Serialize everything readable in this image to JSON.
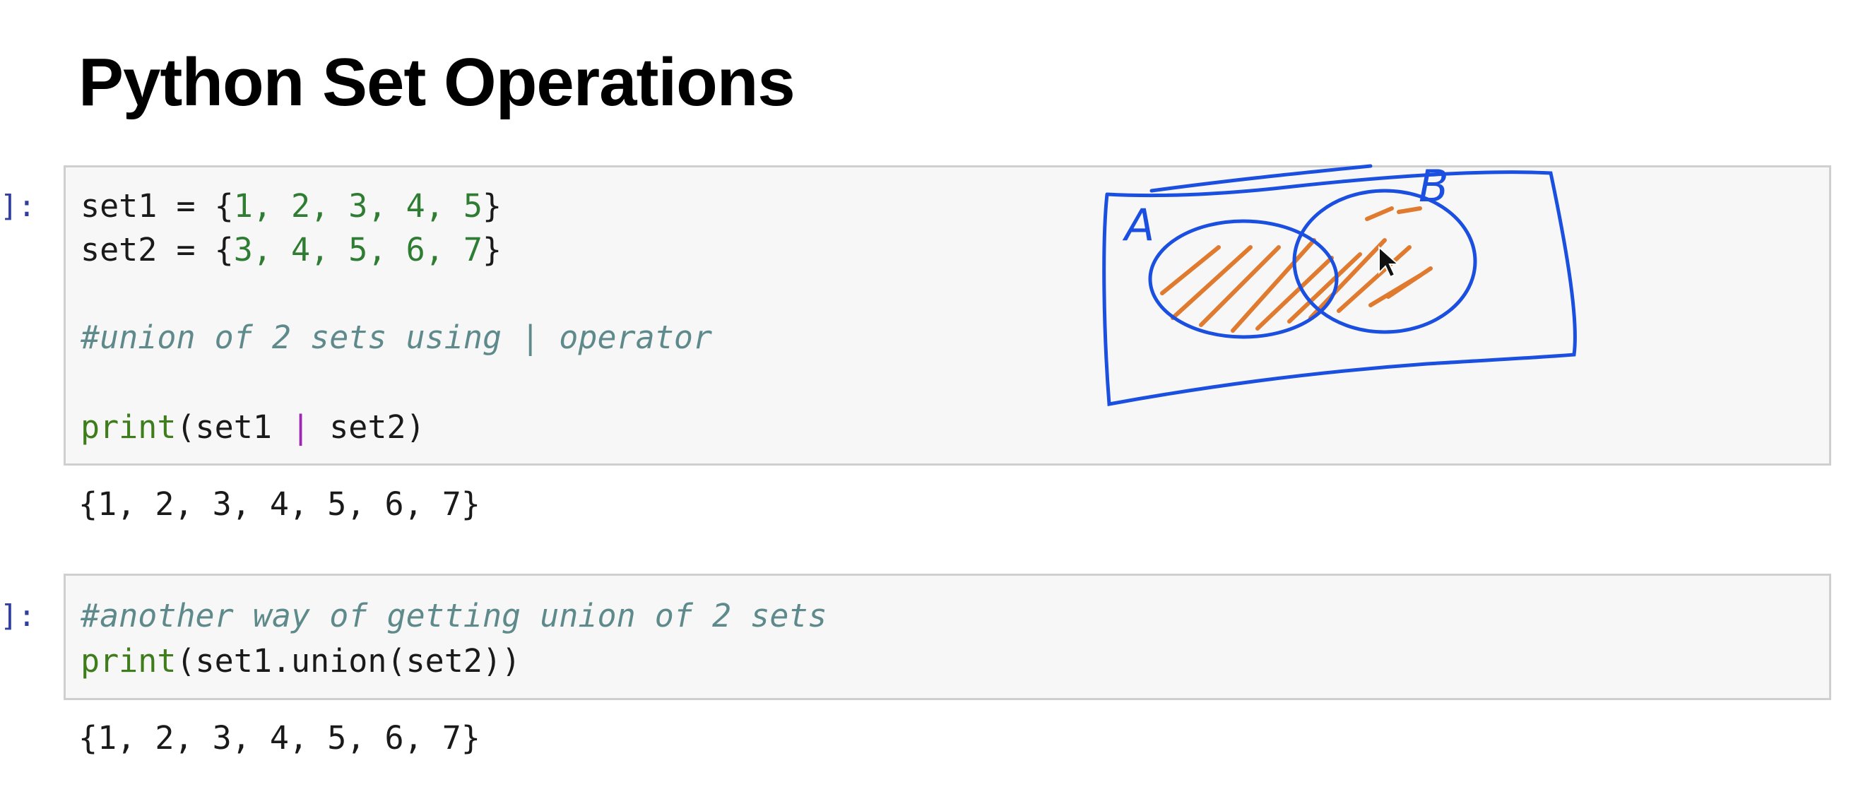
{
  "notebook": {
    "title": "Python Set Operations",
    "cells": [
      {
        "prompt": "]:",
        "lines": {
          "set1_var": "set1 = {",
          "set1_values": "1, 2, 3, 4, 5",
          "set1_close": "}",
          "set2_var": "set2 = {",
          "set2_values": "3, 4, 5, 6, 7",
          "set2_close": "}",
          "comment": "#union of 2 sets using | operator",
          "print_fn": "print",
          "print_arg1": "(set1 ",
          "print_pipe": "|",
          "print_arg2": " set2)"
        },
        "output": "{1, 2, 3, 4, 5, 6, 7}"
      },
      {
        "prompt": "]:",
        "lines": {
          "comment": "#another way of getting union of 2 sets",
          "print_fn": "print",
          "print_rest": "(set1.union(set2))"
        },
        "output": "{1, 2, 3, 4, 5, 6, 7}"
      }
    ]
  },
  "annotation": {
    "label_a": "A",
    "label_b": "B",
    "ink_color": "#1a4fe0",
    "hatch_color": "#e07a2e"
  },
  "colors": {
    "number": "#2e7d32",
    "keyword": "#3f7d1c",
    "comment": "#5f8a8b",
    "operator_pipe": "#9c27b0",
    "prompt": "#303f9f",
    "cell_bg": "#f7f7f7",
    "cell_border": "#cfcfcf"
  }
}
